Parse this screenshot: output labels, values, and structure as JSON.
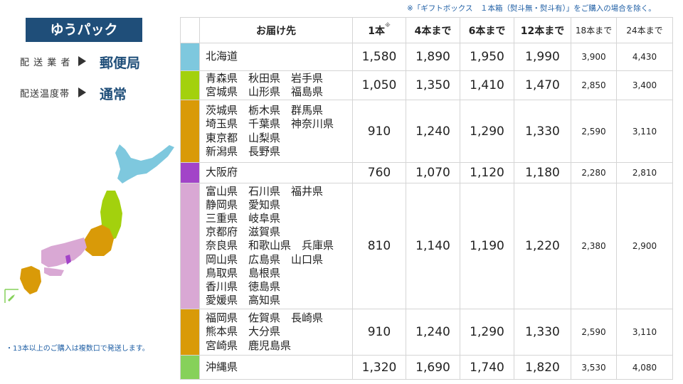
{
  "top_note": "※「ギフトボックス　１本箱（熨斗無・熨斗有）」をご購入の場合を除く。",
  "brand": "ゆうパック",
  "info": [
    {
      "label": "配 送 業 者",
      "value": "郵便局"
    },
    {
      "label": "配送温度帯",
      "value": "通常"
    }
  ],
  "bottom_note": "・13本以上のご購入は複数口で発送します。",
  "headers": {
    "destination": "お届け先",
    "one": "1本",
    "one_mark": "※",
    "four": "4本まで",
    "six": "6本まで",
    "twelve": "12本まで",
    "eighteen": "18本まで",
    "twentyfour": "24本まで"
  },
  "rows": [
    {
      "color": "#7ec8de",
      "lines": [
        "北海道"
      ],
      "prices": [
        "1,580",
        "1,890",
        "1,950",
        "1,990",
        "3,900",
        "4,430"
      ]
    },
    {
      "color": "#a3d10d",
      "lines": [
        "青森県　秋田県　岩手県",
        "宮城県　山形県　福島県"
      ],
      "prices": [
        "1,050",
        "1,350",
        "1,410",
        "1,470",
        "2,850",
        "3,400"
      ]
    },
    {
      "color": "#d99a08",
      "lines": [
        "茨城県　栃木県　群馬県",
        "埼玉県　千葉県　神奈川県",
        "東京都　山梨県",
        "新潟県　長野県"
      ],
      "prices": [
        "910",
        "1,240",
        "1,290",
        "1,330",
        "2,590",
        "3,110"
      ]
    },
    {
      "color": "#a244c8",
      "lines": [
        "大阪府"
      ],
      "prices": [
        "760",
        "1,070",
        "1,120",
        "1,180",
        "2,280",
        "2,810"
      ]
    },
    {
      "color": "#d9a8d4",
      "lines": [
        "富山県　石川県　福井県",
        "静岡県　愛知県",
        "三重県　岐阜県",
        "京都府　滋賀県",
        "奈良県　和歌山県　兵庫県",
        "岡山県　広島県　山口県",
        "鳥取県　島根県",
        "香川県　徳島県",
        "愛媛県　高知県"
      ],
      "prices": [
        "810",
        "1,140",
        "1,190",
        "1,220",
        "2,380",
        "2,900"
      ]
    },
    {
      "color": "#d99a08",
      "lines": [
        "福岡県　佐賀県　長崎県",
        "熊本県　大分県",
        "宮崎県　鹿児島県"
      ],
      "prices": [
        "910",
        "1,240",
        "1,290",
        "1,330",
        "2,590",
        "3,110"
      ]
    },
    {
      "color": "#86d15a",
      "lines": [
        "沖縄県"
      ],
      "prices": [
        "1,320",
        "1,690",
        "1,740",
        "1,820",
        "3,530",
        "4,080"
      ]
    }
  ]
}
